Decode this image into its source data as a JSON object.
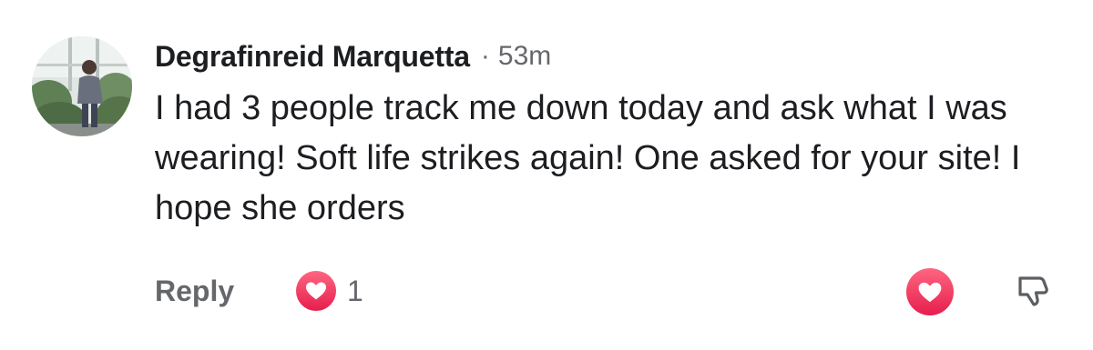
{
  "comment": {
    "author": "Degrafinreid Marquetta",
    "separator": "·",
    "time": "53m",
    "text": "I had 3 people track me down today and ask what I was wearing! Soft life strikes again! One asked for your site! I hope she orders"
  },
  "actions": {
    "reply_label": "Reply",
    "reaction_count": "1",
    "reaction_icon": "heart-icon",
    "like_icon": "heart-icon",
    "dislike_icon": "thumbs-down-icon"
  },
  "colors": {
    "text_primary": "#1c1e21",
    "text_secondary": "#65676b",
    "heart_red": "#f02849"
  }
}
